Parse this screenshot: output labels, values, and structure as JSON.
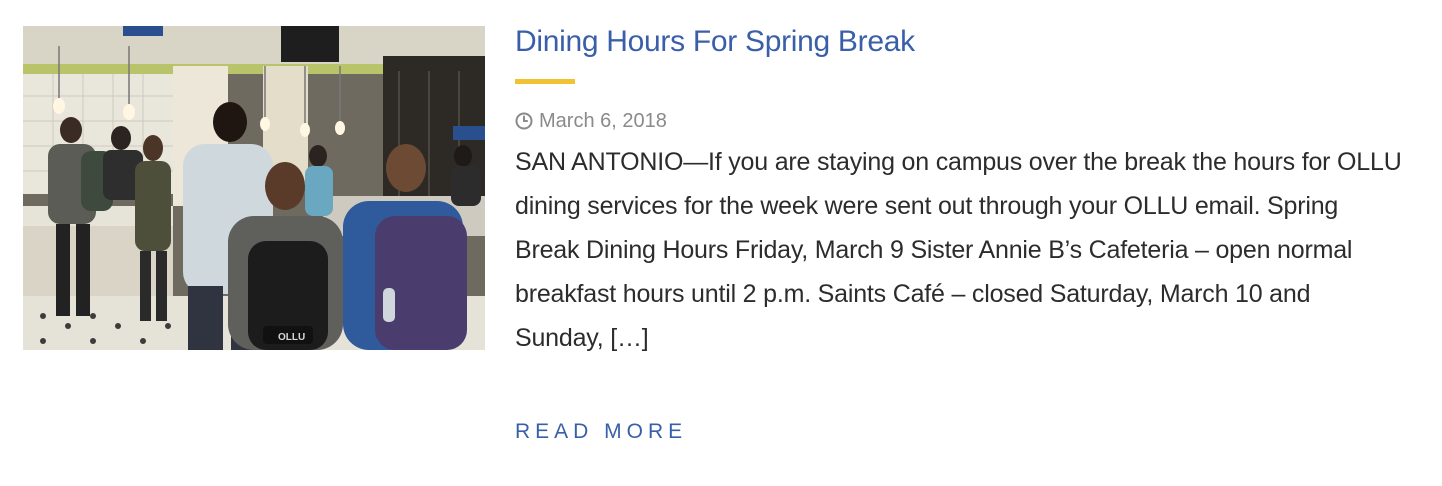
{
  "post": {
    "title": "Dining Hours For Spring Break",
    "date": "March 6, 2018",
    "excerpt": "SAN ANTONIO—If you are staying on campus over the break the hours for OLLU dining services for the week were sent out through your OLLU email.   Spring Break Dining Hours Friday, March 9 Sister Annie B’s Cafeteria – open normal breakfast hours until 2 p.m. Saints Café – closed Saturday, March 10 and Sunday, […]",
    "read_more_label": "READ MORE",
    "date_icon": "clock-icon",
    "thumbnail_backpack_text": "OLLU"
  },
  "colors": {
    "title": "#3a5fa8",
    "accent": "#f1c232",
    "meta": "#8a8a8a",
    "body_text": "#2c2c2c",
    "link": "#3a5fa8"
  }
}
